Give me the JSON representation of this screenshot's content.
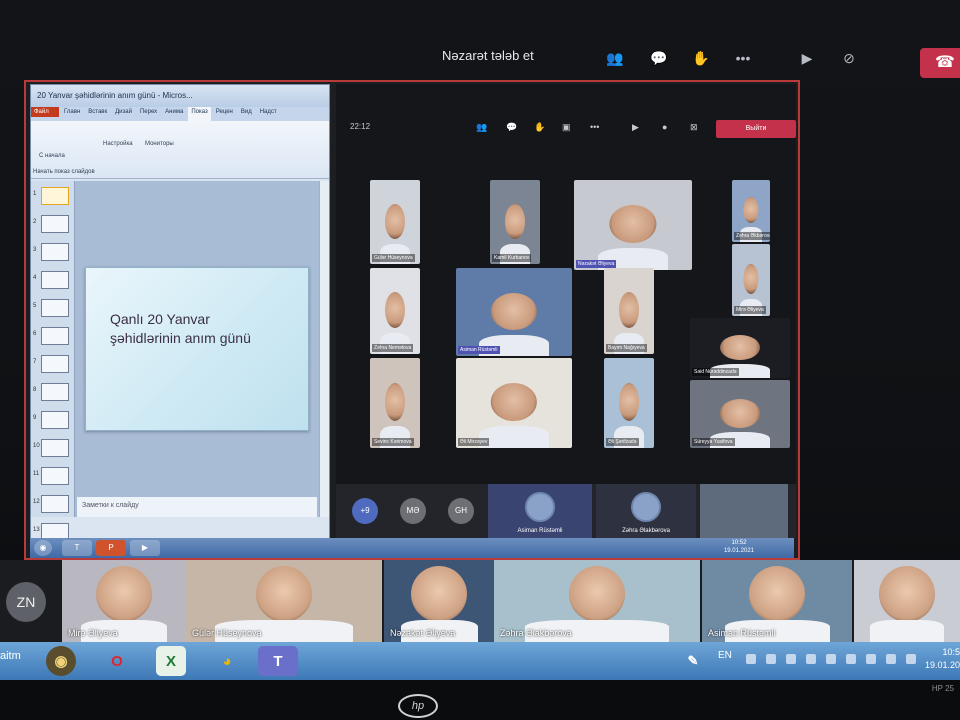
{
  "outer_meeting": {
    "title": "Nəzarət tələb et",
    "controls": [
      "people-icon",
      "chat-icon",
      "raise-hand-icon",
      "more-icon",
      "camera-icon",
      "mic-off-icon"
    ],
    "hangup_label": "☎"
  },
  "ppt": {
    "window_title": "20 Yanvar şəhidlərinin anım günü - Micros...",
    "tabs": [
      "Файл",
      "Главн",
      "Вставк",
      "Дизай",
      "Перех",
      "Анима",
      "Показ",
      "Рецен",
      "Вид",
      "Надст"
    ],
    "ribbon_labels": [
      "С начала",
      "Настройка",
      "Мониторы",
      "Начать показ слайдов"
    ],
    "slide_title": "Qanlı 20 Yanvar\nşəhidlərinin anım günü",
    "notes_placeholder": "Заметки к слайду",
    "thumb_numbers": [
      "1",
      "2",
      "3",
      "4",
      "5",
      "6",
      "7",
      "8",
      "9",
      "10",
      "11",
      "12",
      "13"
    ],
    "clock_time": "10:52",
    "clock_date": "19.01.2021"
  },
  "inner_meeting": {
    "time": "22:12",
    "leave_label": "Выйти",
    "participants": [
      "Gülər Hüseynova",
      "Kamil Kurbanov",
      "Nəzakət Əliyeva",
      "Zəhra Əkbərova",
      "Zəhra Nemətova",
      "Asiman Rüstəmli",
      "Bayım Nağıyeva",
      "Mirə Əliyeva",
      "Səid Nurəddinzadə",
      "Sevinc Kərimova",
      "Əli Mirzəyev",
      "Əli Şərifzadə",
      "Süreyya Yusifova"
    ],
    "more_count": "+9",
    "avatars": [
      "MƏ",
      "GH"
    ],
    "bottom_names": [
      "Asiman Rüstəmli",
      "Zəhra Əlakbərova"
    ]
  },
  "gallery": {
    "initials": "ZN",
    "names": [
      "Mirə Əliyeva",
      "Gülər Hüseynova",
      "Nəzakət Əliyeva",
      "Zəhra Əlakbərova",
      "Asiman Rüstəmli",
      ""
    ]
  },
  "taskbar": {
    "start_label": "aitm",
    "apps": [
      "mind-icon",
      "opera-icon",
      "excel-icon",
      "chrome-icon",
      "teams-icon"
    ],
    "lang": "EN",
    "time": "10:5",
    "date": "19.01.20"
  },
  "bezel": {
    "brand": "hp",
    "model": "HP 25"
  }
}
